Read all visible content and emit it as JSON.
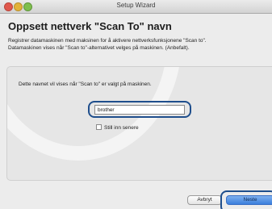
{
  "window": {
    "title": "Setup Wizard"
  },
  "page": {
    "heading": "Oppsett nettverk \"Scan To\" navn",
    "intro_line1": "Registrer datamaskinen med maksinen for å aktivere nettverksfunksjonene \"Scan to\".",
    "intro_line2": "Datamaskinen vises når \"Scan to\"-alternativet velges på maskinen. (Anbefalt)."
  },
  "form": {
    "instruction": "Dette navnet vil vises når \"Scan to\" er valgt på maskinen.",
    "name_value": "brother",
    "checkbox_label": "Still inn senere",
    "checkbox_checked": false
  },
  "buttons": {
    "back_label": "Avbryt",
    "next_label": "Neste"
  },
  "colors": {
    "highlight": "#1f4e8c",
    "default_button": "#3a7fdc"
  }
}
